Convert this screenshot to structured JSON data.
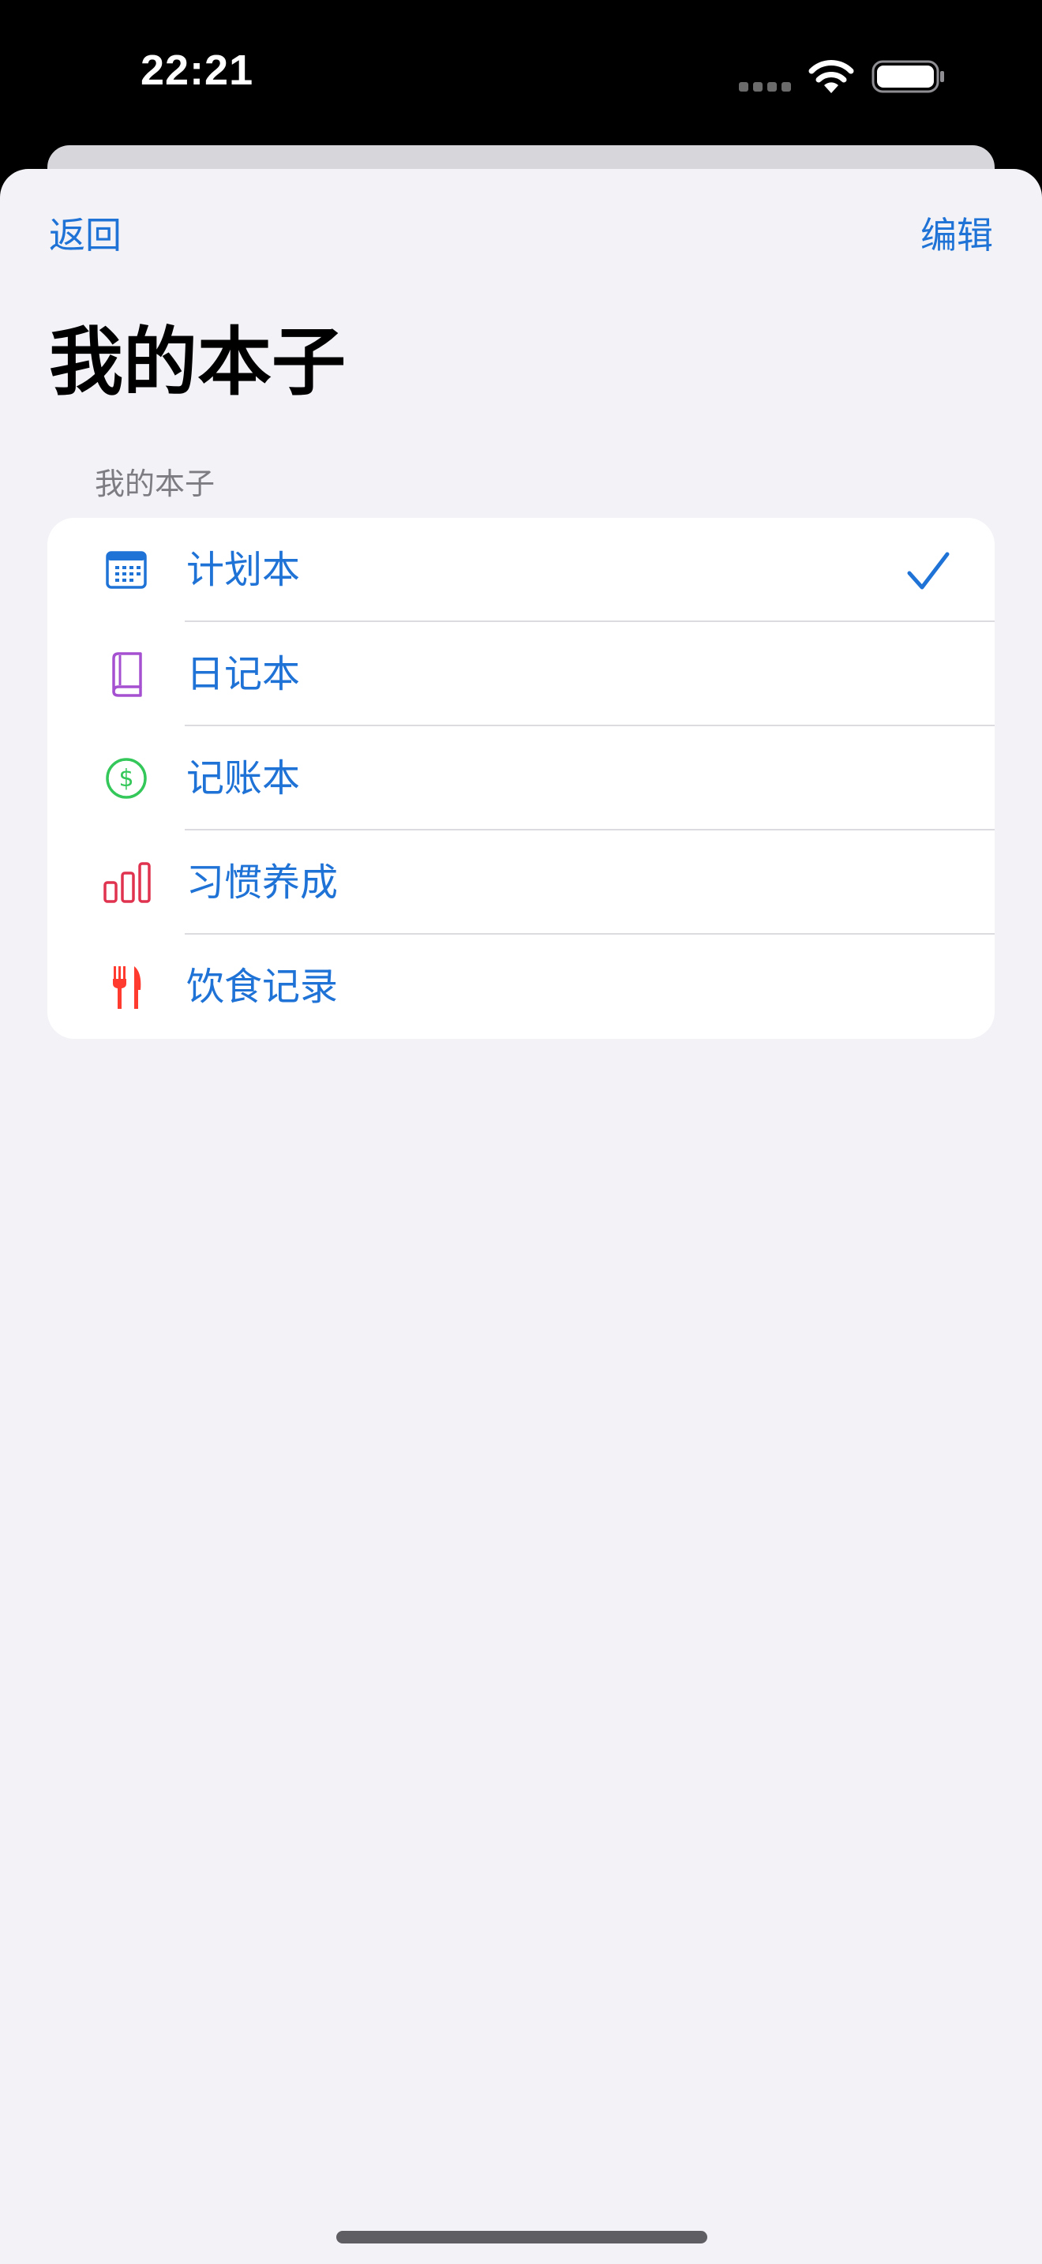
{
  "status_bar": {
    "time": "22:21"
  },
  "nav": {
    "back_label": "返回",
    "edit_label": "编辑"
  },
  "page": {
    "title": "我的本子",
    "section_header": "我的本子"
  },
  "notebooks": [
    {
      "label": "计划本",
      "icon": "calendar-icon",
      "icon_color": "#1f72d6",
      "selected": true
    },
    {
      "label": "日记本",
      "icon": "book-icon",
      "icon_color": "#a550d0",
      "selected": false
    },
    {
      "label": "记账本",
      "icon": "dollar-circle-icon",
      "icon_color": "#34c759",
      "selected": false
    },
    {
      "label": "习惯养成",
      "icon": "bar-chart-icon",
      "icon_color": "#e0334f",
      "selected": false
    },
    {
      "label": "饮食记录",
      "icon": "fork-knife-icon",
      "icon_color": "#ff3b30",
      "selected": false
    }
  ],
  "colors": {
    "accent": "#1f72d6",
    "background": "#f2f2f7",
    "card": "#ffffff"
  }
}
